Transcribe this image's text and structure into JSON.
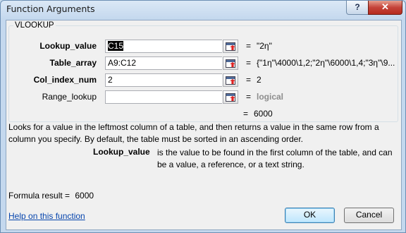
{
  "window": {
    "title": "Function Arguments",
    "help_label": "?",
    "close_label": "✕"
  },
  "function_name": "VLOOKUP",
  "arguments": [
    {
      "label": "Lookup_value",
      "value": "C15",
      "result": "\"2η\""
    },
    {
      "label": "Table_array",
      "value": "A9:C12",
      "result": "{\"1η\"\\4000\\1,2;\"2η\"\\6000\\1,4;\"3η\"\\9..."
    },
    {
      "label": "Col_index_num",
      "value": "2",
      "result": "2"
    },
    {
      "label": "Range_lookup",
      "value": "",
      "result": "logical"
    }
  ],
  "overall_result": "6000",
  "description": "Looks for a value in the leftmost column of a table, and then returns a value in the same row from a column you specify. By default, the table must be sorted in an ascending order.",
  "current_argument": {
    "name": "Lookup_value",
    "text": "is the value to be found in the first column of the table, and can be a value, a reference, or a text string."
  },
  "formula_result_label": "Formula result =",
  "formula_result_value": "6000",
  "help_link": "Help on this function",
  "buttons": {
    "ok": "OK",
    "cancel": "Cancel"
  }
}
